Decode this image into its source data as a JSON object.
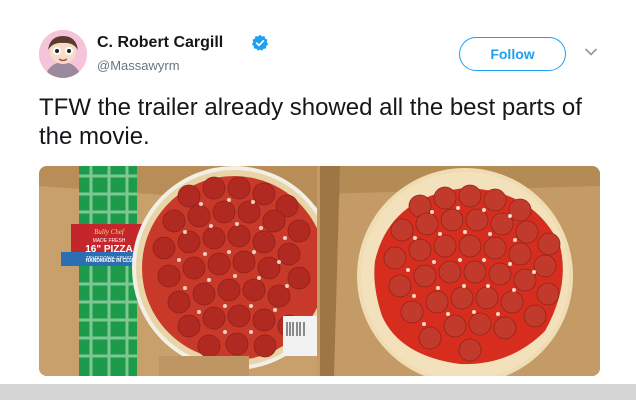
{
  "user": {
    "display_name": "C. Robert Cargill",
    "handle": "@Massawyrm",
    "verified": true,
    "avatar_icon": "cartoon-avatar-icon"
  },
  "actions": {
    "follow_label": "Follow",
    "menu_icon": "chevron-down-icon"
  },
  "tweet": {
    "text": "TFW the trailer already showed all the best parts of the movie."
  },
  "media": {
    "left_photo": {
      "box_brand": "Bully Chef",
      "box_line1": "MADE FRESH",
      "box_size": "16\" PIZZA",
      "box_line2": "TRADITIONAL CRUST",
      "box_banner": "HANDMADE IN CLUB"
    },
    "right_photo": {}
  },
  "colors": {
    "accent": "#1da1f2",
    "cardboard": "#c49a66",
    "pepperoni": "#c9392a",
    "sauce": "#d62d1f"
  }
}
